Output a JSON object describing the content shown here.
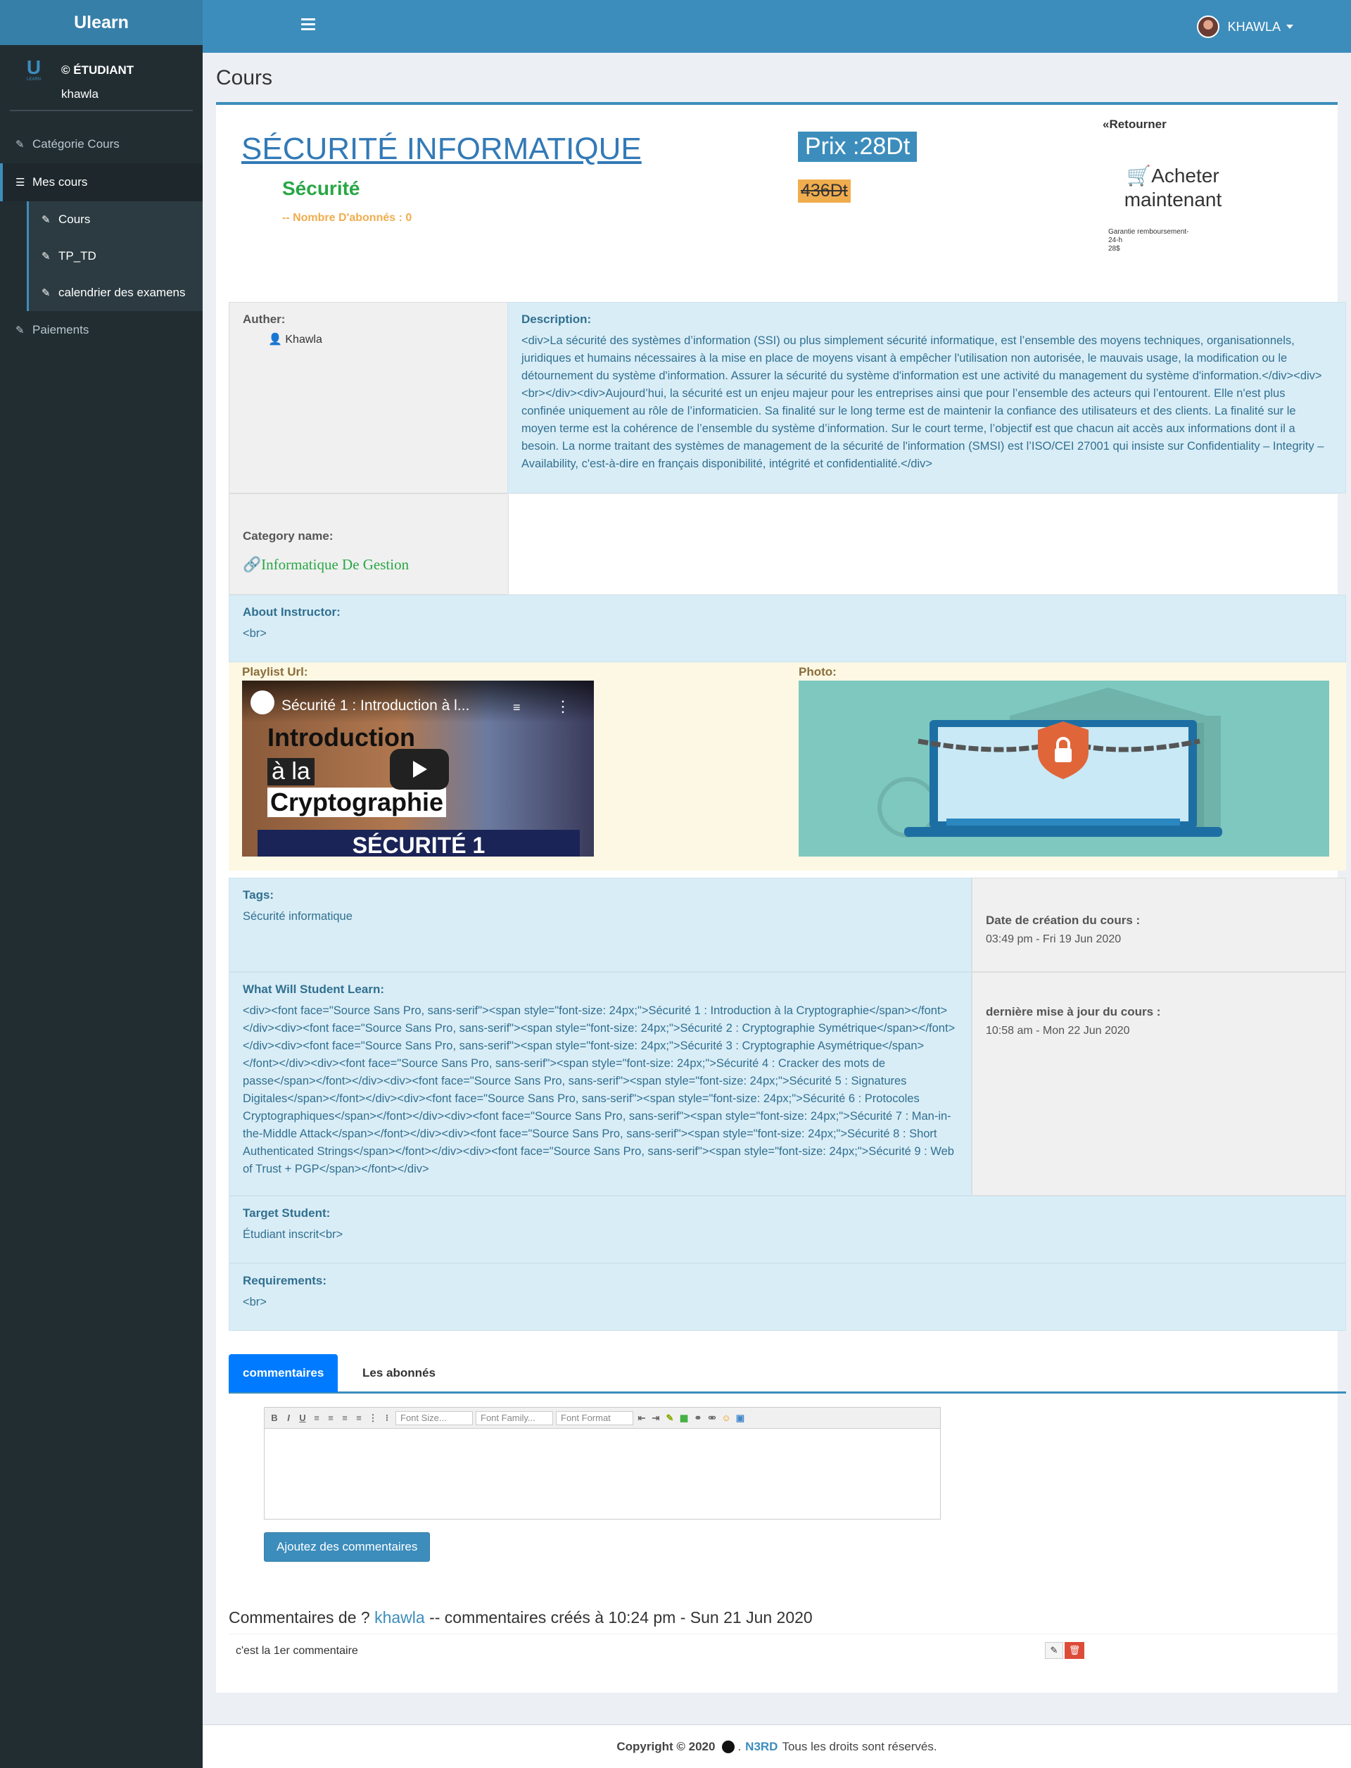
{
  "app": {
    "name": "Ulearn"
  },
  "topbar": {
    "user_name": "KHAWLA"
  },
  "sidebar": {
    "logo_letter": "U",
    "logo_sub": "LEARN",
    "role": "© ÉTUDIANT",
    "username": "khawla",
    "items": [
      {
        "label": "Catégorie Cours"
      },
      {
        "label": "Mes cours"
      },
      {
        "label": "Cours"
      },
      {
        "label": "TP_TD"
      },
      {
        "label": "calendrier des examens"
      },
      {
        "label": "Paiements"
      }
    ]
  },
  "page": {
    "title": "Cours"
  },
  "course": {
    "title": "SÉCURITÉ INFORMATIQUE",
    "subtitle": "Sécurité",
    "subscribers": "-- Nombre D'abonnés : 0",
    "price": "Prix :28Dt",
    "old_price": "436Dt",
    "back": "«Retourner",
    "buy": "Acheter maintenant",
    "guarantee_1": "Garantie remboursement-",
    "guarantee_2": "24-h",
    "guarantee_3": "28$"
  },
  "details": {
    "author_label": "Auther:",
    "author_name": "Khawla",
    "description_label": "Description:",
    "description": "<div>La sécurité des systèmes d’information (SSI) ou plus simplement sécurité informatique, est l’ensemble des moyens techniques, organisationnels, juridiques et humains nécessaires à la mise en place de moyens visant à empêcher l'utilisation non autorisée, le mauvais usage, la modification ou le détournement du système d'information. Assurer la sécurité du système d'information est une activité du management du système d'information.</div><div><br></div><div>Aujourd’hui, la sécurité est un enjeu majeur pour les entreprises ainsi que pour l’ensemble des acteurs qui l’entourent. Elle n'est plus confinée uniquement au rôle de l’informaticien. Sa finalité sur le long terme est de maintenir la confiance des utilisateurs et des clients. La finalité sur le moyen terme est la cohérence de l’ensemble du système d’information. Sur le court terme, l’objectif est que chacun ait accès aux informations dont il a besoin. La norme traitant des systèmes de management de la sécurité de l'information (SMSI) est l’ISO/CEI 27001 qui insiste sur Confidentiality – Integrity – Availability, c'est-à-dire en français disponibilité, intégrité et confidentialité.</div>",
    "category_label": "Category name:",
    "category_value": "Informatique De Gestion",
    "instructor_label": "About Instructor:",
    "instructor_value": "<br>",
    "playlist_label": "Playlist Url:",
    "photo_label": "Photo:",
    "video_title": "Sécurité 1 : Introduction à l...",
    "video_line1": "Introduction",
    "video_line2": "à la",
    "video_line3": "Cryptographie",
    "video_banner": "SÉCURITÉ 1",
    "tags_label": "Tags:",
    "tags_value": "Sécurité informatique",
    "created_label": "Date de création du cours :",
    "created_value": "03:49 pm - Fri 19 Jun 2020",
    "learn_label": "What Will Student Learn:",
    "learn_value": "<div><font face=\"Source Sans Pro, sans-serif\"><span style=\"font-size: 24px;\">Sécurité 1 : Introduction à la Cryptographie</span></font></div><div><font face=\"Source Sans Pro, sans-serif\"><span style=\"font-size: 24px;\">Sécurité 2 : Cryptographie Symétrique</span></font></div><div><font face=\"Source Sans Pro, sans-serif\"><span style=\"font-size: 24px;\">Sécurité 3 : Cryptographie Asymétrique</span></font></div><div><font face=\"Source Sans Pro, sans-serif\"><span style=\"font-size: 24px;\">Sécurité 4 : Cracker des mots de passe</span></font></div><div><font face=\"Source Sans Pro, sans-serif\"><span style=\"font-size: 24px;\">Sécurité 5 : Signatures Digitales</span></font></div><div><font face=\"Source Sans Pro, sans-serif\"><span style=\"font-size: 24px;\">Sécurité 6 : Protocoles Cryptographiques</span></font></div><div><font face=\"Source Sans Pro, sans-serif\"><span style=\"font-size: 24px;\">Sécurité 7 : Man-in-the-Middle Attack</span></font></div><div><font face=\"Source Sans Pro, sans-serif\"><span style=\"font-size: 24px;\">Sécurité 8 : Short Authenticated Strings</span></font></div><div><font face=\"Source Sans Pro, sans-serif\"><span style=\"font-size: 24px;\">Sécurité 9 : Web of Trust + PGP</span></font></div>",
    "updated_label": "dernière mise à jour du cours :",
    "updated_value": "10:58 am - Mon 22 Jun 2020",
    "target_label": "Target Student:",
    "target_value": "Étudiant inscrit<br>",
    "req_label": "Requirements:",
    "req_value": "<br>"
  },
  "tabs": [
    {
      "label": "commentaires"
    },
    {
      "label": "Les abonnés"
    }
  ],
  "editor": {
    "font_size": "Font Size...",
    "font_family": "Font Family...",
    "font_format": "Font Format",
    "submit": "Ajoutez des commentaires"
  },
  "comments": {
    "prefix": "Commentaires de ?",
    "author": "khawla",
    "suffix": "-- commentaires créés à 10:24 pm - Sun 21 Jun 2020",
    "items": [
      {
        "text": "c'est la 1er commentaire"
      }
    ]
  },
  "footer": {
    "copyright": "Copyright © 2020",
    "brand": "N3RD",
    "rights": "Tous les droits sont réservés."
  },
  "colors": {
    "primary": "#3c8dbc",
    "sidebar": "#222d32",
    "success": "#28a745",
    "warning": "#f0ad4e",
    "danger": "#dd4b39"
  }
}
